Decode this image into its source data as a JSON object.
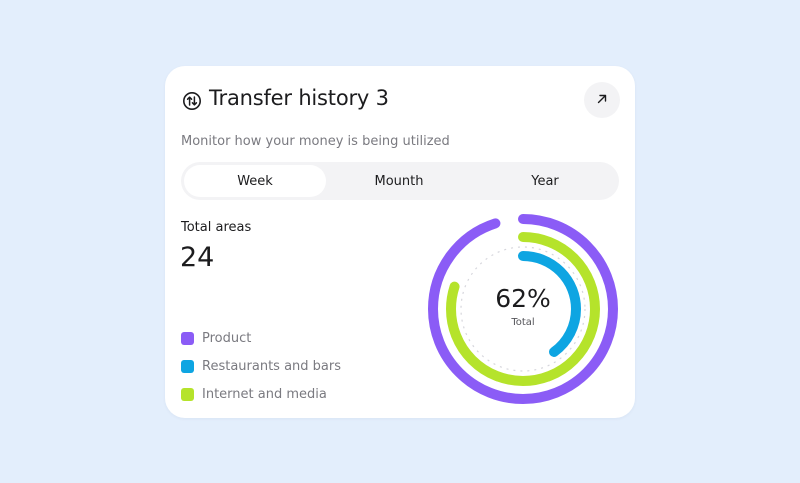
{
  "card": {
    "title": "Transfer history 3",
    "subtitle": "Monitor how your money is being utilized",
    "header_icon": "transfer-arrows-icon",
    "expand_icon": "arrow-up-right-icon"
  },
  "tabs": [
    {
      "label": "Week",
      "active": true
    },
    {
      "label": "Mounth",
      "active": false
    },
    {
      "label": "Year",
      "active": false
    }
  ],
  "stat": {
    "label": "Total areas",
    "value": "24"
  },
  "legend": [
    {
      "label": "Product",
      "color": "#8b5cf6"
    },
    {
      "label": "Restaurants and bars",
      "color": "#0ea5e2"
    },
    {
      "label": "Internet and media",
      "color": "#b5e32b"
    }
  ],
  "chart_data": {
    "type": "donut",
    "center_value": "62%",
    "center_label": "Total",
    "series": [
      {
        "name": "Product",
        "fraction": 0.95,
        "color": "#8b5cf6"
      },
      {
        "name": "Internet and media",
        "fraction": 0.8,
        "color": "#b5e32b"
      },
      {
        "name": "Restaurants and bars",
        "fraction": 0.4,
        "color": "#0ea5e2"
      }
    ]
  }
}
